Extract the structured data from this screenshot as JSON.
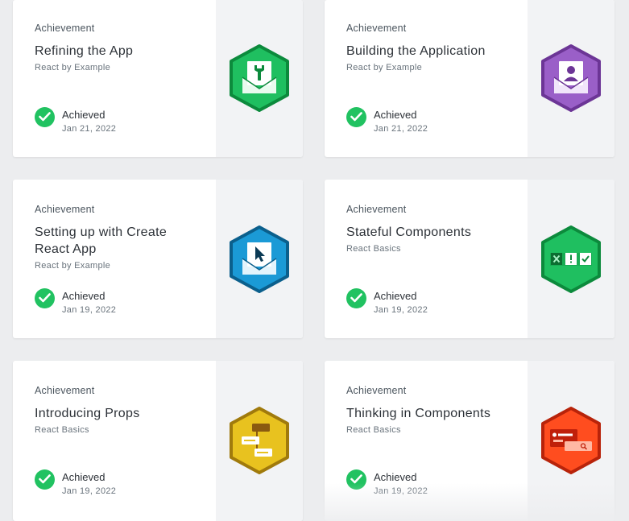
{
  "cards": [
    {
      "kind": "Achievement",
      "title": "Refining the App",
      "course": "React by Example",
      "status": "Achieved",
      "date": "Jan 21, 2022",
      "badge_icon": "wrench-envelope-icon",
      "badge_color": "#1fbf60",
      "badge_border": "#0c8a3c"
    },
    {
      "kind": "Achievement",
      "title": "Building the Application",
      "course": "React by Example",
      "status": "Achieved",
      "date": "Jan 21, 2022",
      "badge_icon": "person-envelope-icon",
      "badge_color": "#9a5fc8",
      "badge_border": "#6c3596"
    },
    {
      "kind": "Achievement",
      "title": "Setting up with Create React App",
      "course": "React by Example",
      "status": "Achieved",
      "date": "Jan 19, 2022",
      "badge_icon": "cursor-envelope-icon",
      "badge_color": "#1b9ad6",
      "badge_border": "#0b5f8c"
    },
    {
      "kind": "Achievement",
      "title": "Stateful Components",
      "course": "React Basics",
      "status": "Achieved",
      "date": "Jan 19, 2022",
      "badge_icon": "state-boxes-icon",
      "badge_color": "#1fbf60",
      "badge_border": "#0c8a3c"
    },
    {
      "kind": "Achievement",
      "title": "Introducing Props",
      "course": "React Basics",
      "status": "Achieved",
      "date": "Jan 19, 2022",
      "badge_icon": "props-tree-icon",
      "badge_color": "#e8c21f",
      "badge_border": "#a07a0c"
    },
    {
      "kind": "Achievement",
      "title": "Thinking in Components",
      "course": "React Basics",
      "status": "Achieved",
      "date": "Jan 19, 2022",
      "badge_icon": "components-search-icon",
      "badge_color": "#ff4d1f",
      "badge_border": "#b8230a"
    }
  ],
  "colors": {
    "check_green": "#21c261",
    "page_bg": "#ecedef"
  }
}
